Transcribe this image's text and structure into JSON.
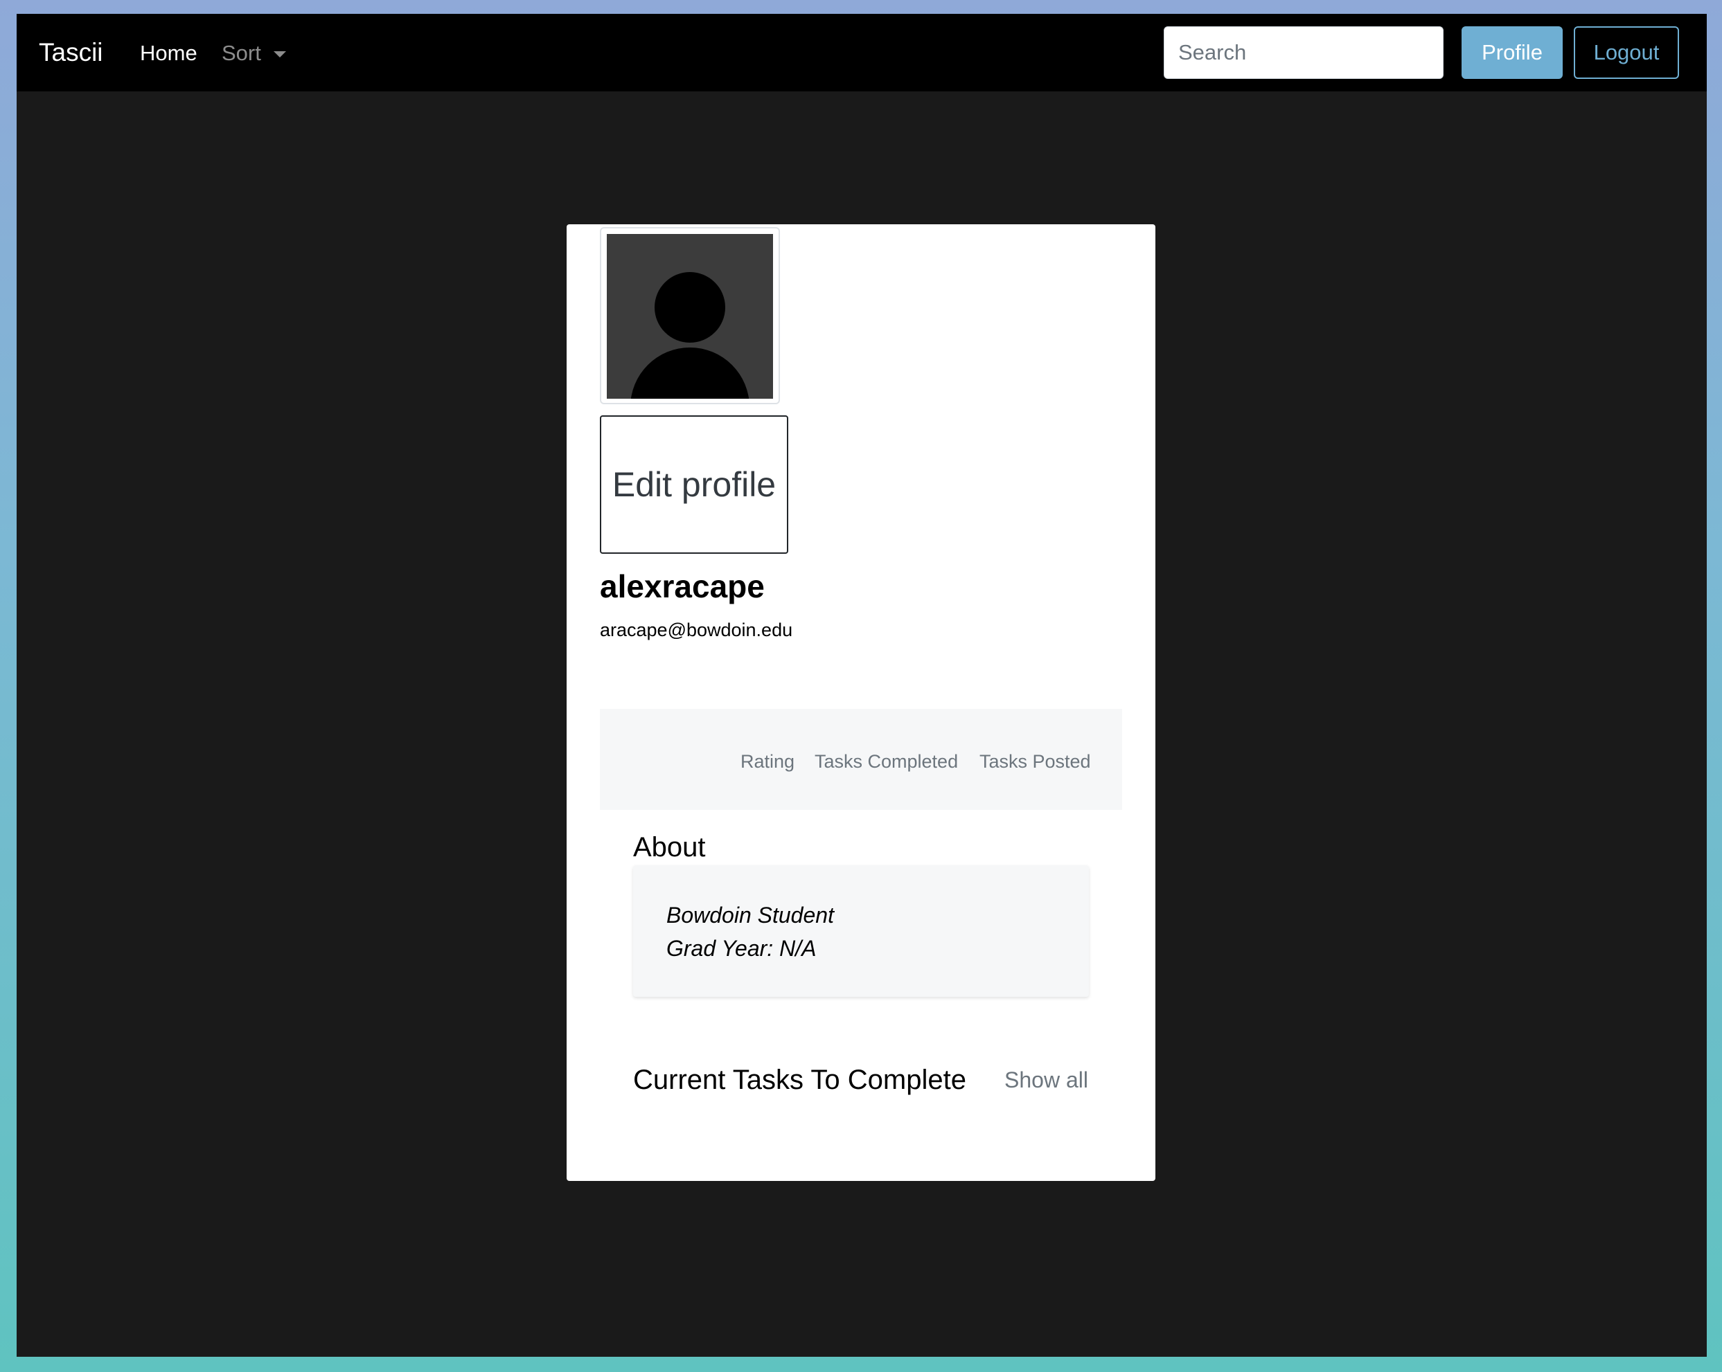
{
  "navbar": {
    "brand": "Tascii",
    "home_label": "Home",
    "sort_label": "Sort",
    "search_placeholder": "Search",
    "profile_label": "Profile",
    "logout_label": "Logout"
  },
  "profile": {
    "edit_label": "Edit profile",
    "username": "alexracape",
    "email": "aracape@bowdoin.edu",
    "stats": {
      "rating_label": "Rating",
      "tasks_completed_label": "Tasks Completed",
      "tasks_posted_label": "Tasks Posted"
    },
    "about": {
      "heading": "About",
      "line1": "Bowdoin Student",
      "line2": "Grad Year: N/A"
    },
    "tasks": {
      "heading": "Current Tasks To Complete",
      "show_all_label": "Show all"
    }
  },
  "icons": {
    "avatar": "person-silhouette-icon",
    "sort_caret": "caret-down-icon"
  },
  "colors": {
    "page_background": "#1a1a1a",
    "navbar_background": "#000000",
    "accent": "#6fafd3",
    "card_background": "#ffffff",
    "muted_text": "#6c757d"
  }
}
